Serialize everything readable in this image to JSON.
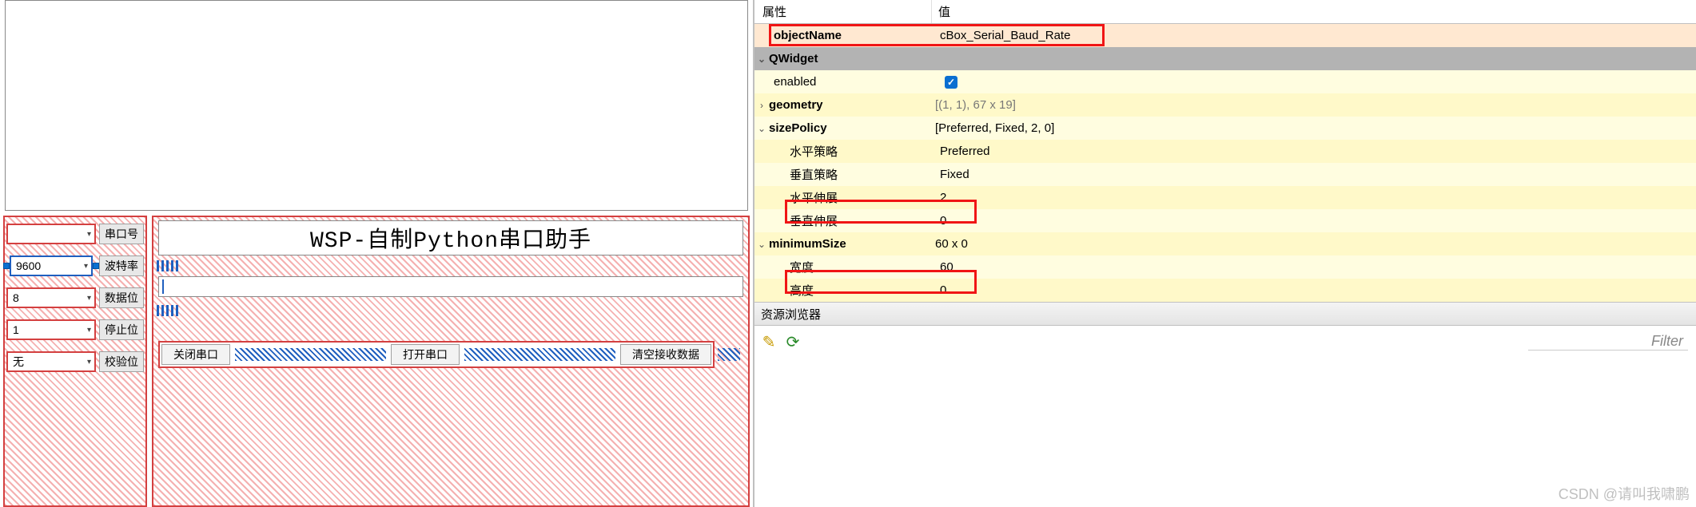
{
  "design": {
    "combos": {
      "serial": {
        "value": "",
        "label": "串口号"
      },
      "baud": {
        "value": "9600",
        "label": "波特率"
      },
      "data": {
        "value": "8",
        "label": "数据位"
      },
      "stop": {
        "value": "1",
        "label": "停止位"
      },
      "parity": {
        "value": "无",
        "label": "校验位"
      }
    },
    "title": "WSP-自制Python串口助手",
    "buttons": {
      "close": "关闭串口",
      "open": "打开串口",
      "clear": "清空接收数据"
    }
  },
  "props": {
    "header": {
      "name": "属性",
      "value": "值"
    },
    "objectName": {
      "label": "objectName",
      "value": "cBox_Serial_Baud_Rate"
    },
    "qwidget": "QWidget",
    "enabled": {
      "label": "enabled"
    },
    "geometry": {
      "label": "geometry",
      "value": "[(1, 1), 67 x 19]"
    },
    "sizePolicy": {
      "label": "sizePolicy",
      "value": "[Preferred, Fixed, 2, 0]"
    },
    "hpolicy": {
      "label": "水平策略",
      "value": "Preferred"
    },
    "vpolicy": {
      "label": "垂直策略",
      "value": "Fixed"
    },
    "hstretch": {
      "label": "水平伸展",
      "value": "2"
    },
    "vstretch": {
      "label": "垂直伸展",
      "value": "0"
    },
    "minSize": {
      "label": "minimumSize",
      "value": "60 x 0"
    },
    "width": {
      "label": "宽度",
      "value": "60"
    },
    "height": {
      "label": "高度",
      "value": "0"
    }
  },
  "resources": {
    "title": "资源浏览器",
    "filter": "Filter"
  },
  "watermark": "CSDN @请叫我啸鹏"
}
